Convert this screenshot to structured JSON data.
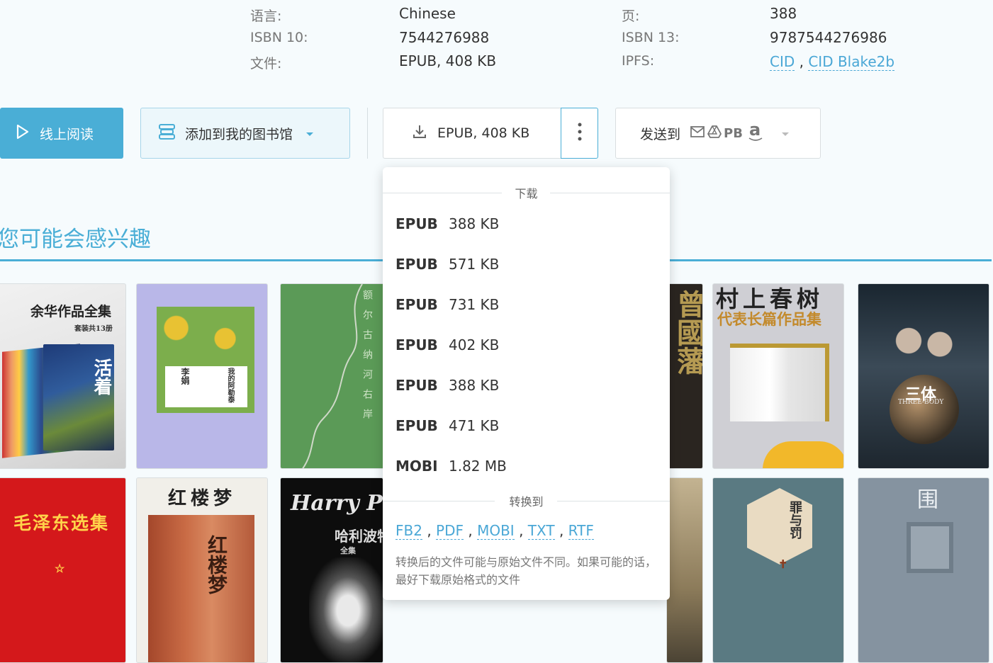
{
  "meta": {
    "language_label": "语言:",
    "language_value": "Chinese",
    "pages_label": "页:",
    "pages_value": "388",
    "isbn10_label": "ISBN 10:",
    "isbn10_value": "7544276988",
    "isbn13_label": "ISBN 13:",
    "isbn13_value": "9787544276986",
    "file_label": "文件:",
    "file_value": "EPUB, 408 KB",
    "ipfs_label": "IPFS:",
    "ipfs_links": [
      "CID",
      "CID Blake2b"
    ],
    "link_separator": ","
  },
  "actions": {
    "read_online": "线上阅读",
    "add_to_library": "添加到我的图书馆",
    "download": "EPUB, 408 KB",
    "send_to": "发送到",
    "send_pb": "PB",
    "send_amazon": "a"
  },
  "section": {
    "title": "您可能会感兴趣"
  },
  "covers": {
    "c1_title": "余华作品全集",
    "c1_sub": "套装共13册",
    "c1_big": "活着",
    "c2_a": "李娟",
    "c2_b": "我的阿勒泰",
    "c3_text": "额尔古纳河右岸",
    "c4_text": "曾國藩",
    "c5_title": "村上春树",
    "c5_sub": "代表长篇作品集",
    "c6_title": "三体",
    "c6_sub": "THREE-BODY",
    "c7_title": "毛泽东选集",
    "c7_star": "☆",
    "c8_title": "红楼梦",
    "c8_big": "红楼梦",
    "c9_title": "Harry Potter",
    "c9_sub": "哈利波特",
    "c9_sub2": "全集",
    "c11_title": "罪与罚",
    "c12_title": "围城"
  },
  "dropdown": {
    "download_header": "下载",
    "items": [
      {
        "format": "EPUB",
        "size": "388 KB"
      },
      {
        "format": "EPUB",
        "size": "571 KB"
      },
      {
        "format": "EPUB",
        "size": "731 KB"
      },
      {
        "format": "EPUB",
        "size": "402 KB"
      },
      {
        "format": "EPUB",
        "size": "388 KB"
      },
      {
        "format": "EPUB",
        "size": "471 KB"
      },
      {
        "format": "MOBI",
        "size": "1.82 MB"
      }
    ],
    "convert_header": "转换到",
    "convert_formats": [
      "FB2",
      "PDF",
      "MOBI",
      "TXT",
      "RTF"
    ],
    "convert_note": "转换后的文件可能与原始文件不同。如果可能的话，最好下载原始格式的文件"
  },
  "colors": {
    "accent": "#4aaed6",
    "link": "#4aa7d6",
    "background": "#f6fbfd"
  },
  "icons": {
    "read": "play-outline-icon",
    "library": "library-stack-icon",
    "download": "download-icon",
    "more": "more-vertical-icon",
    "mail": "mail-icon",
    "drive": "google-drive-icon",
    "amazon": "amazon-icon"
  }
}
